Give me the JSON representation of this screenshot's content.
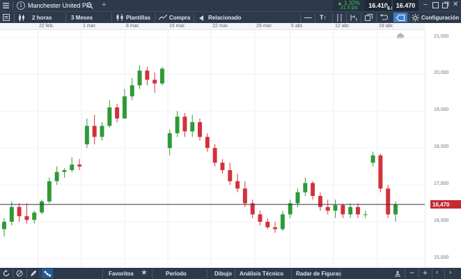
{
  "instrument": {
    "number": "1",
    "name": "Manchester United Plc"
  },
  "quote": {
    "change_pct": "▲ 1.32%",
    "change_pts": "21.5 pts",
    "sell": "16.410",
    "spread": "6.0",
    "buy": "16.470"
  },
  "toolbar": {
    "interval": "2 horas",
    "range": "3 Meses",
    "templates": "Plantillas",
    "buy": "Compra",
    "related": "Relacionado",
    "text_tool": "T↑",
    "settings": "Configuración"
  },
  "date_axis": [
    "22 feb.",
    "1 mar.",
    "8 mar.",
    "15 mar.",
    "22 mar.",
    "29 mar.",
    "5 abr.",
    "12 abr.",
    "19 abr."
  ],
  "price_axis": [
    "21,000",
    "20,000",
    "19,000",
    "18,000",
    "17,000",
    "16,000",
    "15,000"
  ],
  "current_price_label": "16,470",
  "bottom": {
    "favorites": "Favoritos",
    "period": "Período",
    "drawing": "Dibujo",
    "technical": "Análisis Técnico",
    "patterns": "Radar de Figuras"
  },
  "colors": {
    "up": "#2e9a37",
    "down": "#d4313b",
    "bar": "#2c3a4b",
    "price_line": "#2f3338",
    "price_tag": "#c62a33",
    "up_quote": "#3aa63f"
  },
  "chart_data": {
    "type": "candlestick",
    "x_ticks": [
      "22 feb.",
      "1 mar.",
      "8 mar.",
      "15 mar.",
      "22 mar.",
      "29 mar.",
      "5 abr.",
      "12 abr.",
      "19 abr."
    ],
    "ylim": [
      14.75,
      21.2
    ],
    "y_ticks": [
      15,
      16,
      17,
      18,
      19,
      20,
      21
    ],
    "current_price": 16.47,
    "grid": true,
    "series": [
      {
        "date": "18 feb.",
        "ohlc": [
          15.8,
          16.1,
          15.6,
          16.0
        ]
      },
      {
        "date": "19 feb.",
        "ohlc": [
          16.0,
          16.55,
          15.9,
          16.4
        ]
      },
      {
        "date": "20 feb.",
        "ohlc": [
          16.4,
          16.5,
          16.0,
          16.15
        ]
      },
      {
        "date": "21 feb.",
        "ohlc": [
          16.15,
          16.5,
          15.95,
          16.05
        ]
      },
      {
        "date": "22 feb.",
        "ohlc": [
          16.05,
          16.3,
          15.95,
          16.25
        ]
      },
      {
        "date": "23 feb.",
        "ohlc": [
          16.25,
          16.6,
          16.2,
          16.55
        ]
      },
      {
        "date": "24 feb.",
        "ohlc": [
          16.55,
          17.2,
          16.5,
          17.1
        ]
      },
      {
        "date": "25 feb.",
        "ohlc": [
          17.1,
          17.5,
          17.0,
          17.35
        ]
      },
      {
        "date": "26 feb.",
        "ohlc": [
          17.35,
          17.45,
          17.2,
          17.4
        ]
      },
      {
        "date": "27 feb.",
        "ohlc": [
          17.4,
          17.75,
          17.35,
          17.55
        ]
      },
      {
        "date": "28 feb.",
        "ohlc": [
          17.55,
          17.7,
          17.4,
          17.5
        ]
      },
      {
        "date": "1 mar.",
        "ohlc": [
          18.1,
          18.8,
          18.0,
          18.6
        ]
      },
      {
        "date": "2 mar.",
        "ohlc": [
          18.6,
          18.9,
          18.1,
          18.3
        ]
      },
      {
        "date": "3 mar.",
        "ohlc": [
          18.3,
          18.7,
          18.2,
          18.6
        ]
      },
      {
        "date": "4 mar.",
        "ohlc": [
          18.6,
          19.3,
          18.55,
          19.1
        ]
      },
      {
        "date": "5 mar.",
        "ohlc": [
          19.1,
          19.2,
          18.7,
          18.8
        ]
      },
      {
        "date": "6 mar.",
        "ohlc": [
          18.8,
          19.6,
          18.8,
          19.4
        ]
      },
      {
        "date": "7 mar.",
        "ohlc": [
          19.4,
          19.9,
          19.3,
          19.7
        ]
      },
      {
        "date": "8 mar.",
        "ohlc": [
          19.7,
          20.25,
          19.6,
          20.1
        ]
      },
      {
        "date": "9 mar.",
        "ohlc": [
          20.1,
          20.2,
          19.7,
          19.85
        ]
      },
      {
        "date": "10 mar.",
        "ohlc": [
          19.85,
          20.05,
          19.5,
          19.75
        ]
      },
      {
        "date": "11 mar.",
        "ohlc": [
          19.75,
          20.2,
          19.7,
          20.15
        ]
      },
      {
        "date": "14 mar.",
        "ohlc": [
          18.0,
          18.5,
          17.8,
          18.4
        ]
      },
      {
        "date": "15 mar.",
        "ohlc": [
          18.4,
          19.0,
          18.3,
          18.85
        ]
      },
      {
        "date": "16 mar.",
        "ohlc": [
          18.85,
          18.95,
          18.3,
          18.45
        ]
      },
      {
        "date": "17 mar.",
        "ohlc": [
          18.45,
          18.9,
          18.3,
          18.7
        ]
      },
      {
        "date": "18 mar.",
        "ohlc": [
          18.7,
          18.8,
          18.2,
          18.3
        ]
      },
      {
        "date": "19 mar.",
        "ohlc": [
          18.3,
          18.4,
          17.9,
          18.0
        ]
      },
      {
        "date": "20 mar.",
        "ohlc": [
          18.0,
          18.1,
          17.5,
          17.6
        ]
      },
      {
        "date": "21 mar.",
        "ohlc": [
          17.6,
          17.7,
          17.3,
          17.4
        ]
      },
      {
        "date": "22 mar.",
        "ohlc": [
          17.4,
          17.6,
          17.0,
          17.1
        ]
      },
      {
        "date": "23 mar.",
        "ohlc": [
          17.1,
          17.3,
          16.8,
          16.9
        ]
      },
      {
        "date": "24 mar.",
        "ohlc": [
          16.9,
          17.1,
          16.4,
          16.5
        ]
      },
      {
        "date": "25 mar.",
        "ohlc": [
          16.5,
          16.6,
          16.1,
          16.2
        ]
      },
      {
        "date": "26 mar.",
        "ohlc": [
          16.2,
          16.3,
          15.9,
          16.0
        ]
      },
      {
        "date": "29 mar.",
        "ohlc": [
          16.0,
          16.1,
          15.8,
          15.85
        ]
      },
      {
        "date": "30 mar.",
        "ohlc": [
          15.85,
          16.0,
          15.7,
          15.8
        ]
      },
      {
        "date": "31 mar.",
        "ohlc": [
          15.8,
          16.3,
          15.75,
          16.2
        ]
      },
      {
        "date": "1 abr.",
        "ohlc": [
          16.2,
          16.6,
          16.1,
          16.5
        ]
      },
      {
        "date": "2 abr.",
        "ohlc": [
          16.5,
          16.9,
          16.4,
          16.8
        ]
      },
      {
        "date": "5 abr.",
        "ohlc": [
          16.8,
          17.2,
          16.7,
          17.05
        ]
      },
      {
        "date": "6 abr.",
        "ohlc": [
          17.05,
          17.1,
          16.6,
          16.7
        ]
      },
      {
        "date": "7 abr.",
        "ohlc": [
          16.7,
          16.8,
          16.3,
          16.4
        ]
      },
      {
        "date": "8 abr.",
        "ohlc": [
          16.4,
          16.6,
          16.2,
          16.3
        ]
      },
      {
        "date": "9 abr.",
        "ohlc": [
          16.3,
          16.6,
          16.1,
          16.45
        ]
      },
      {
        "date": "12 abr.",
        "ohlc": [
          16.45,
          16.5,
          16.1,
          16.2
        ]
      },
      {
        "date": "13 abr.",
        "ohlc": [
          16.2,
          16.5,
          16.1,
          16.4
        ]
      },
      {
        "date": "14 abr.",
        "ohlc": [
          16.4,
          16.5,
          16.1,
          16.2
        ]
      },
      {
        "date": "15 abr.",
        "ohlc": [
          16.2,
          16.3,
          16.1,
          16.2
        ]
      },
      {
        "date": "16 abr.",
        "ohlc": [
          17.6,
          17.9,
          17.5,
          17.8
        ]
      },
      {
        "date": "19 abr.",
        "ohlc": [
          17.8,
          17.85,
          16.8,
          16.9
        ]
      },
      {
        "date": "20 abr.",
        "ohlc": [
          16.9,
          17.0,
          16.1,
          16.2
        ]
      },
      {
        "date": "21 abr.",
        "ohlc": [
          16.2,
          16.55,
          16.0,
          16.47
        ]
      }
    ]
  }
}
